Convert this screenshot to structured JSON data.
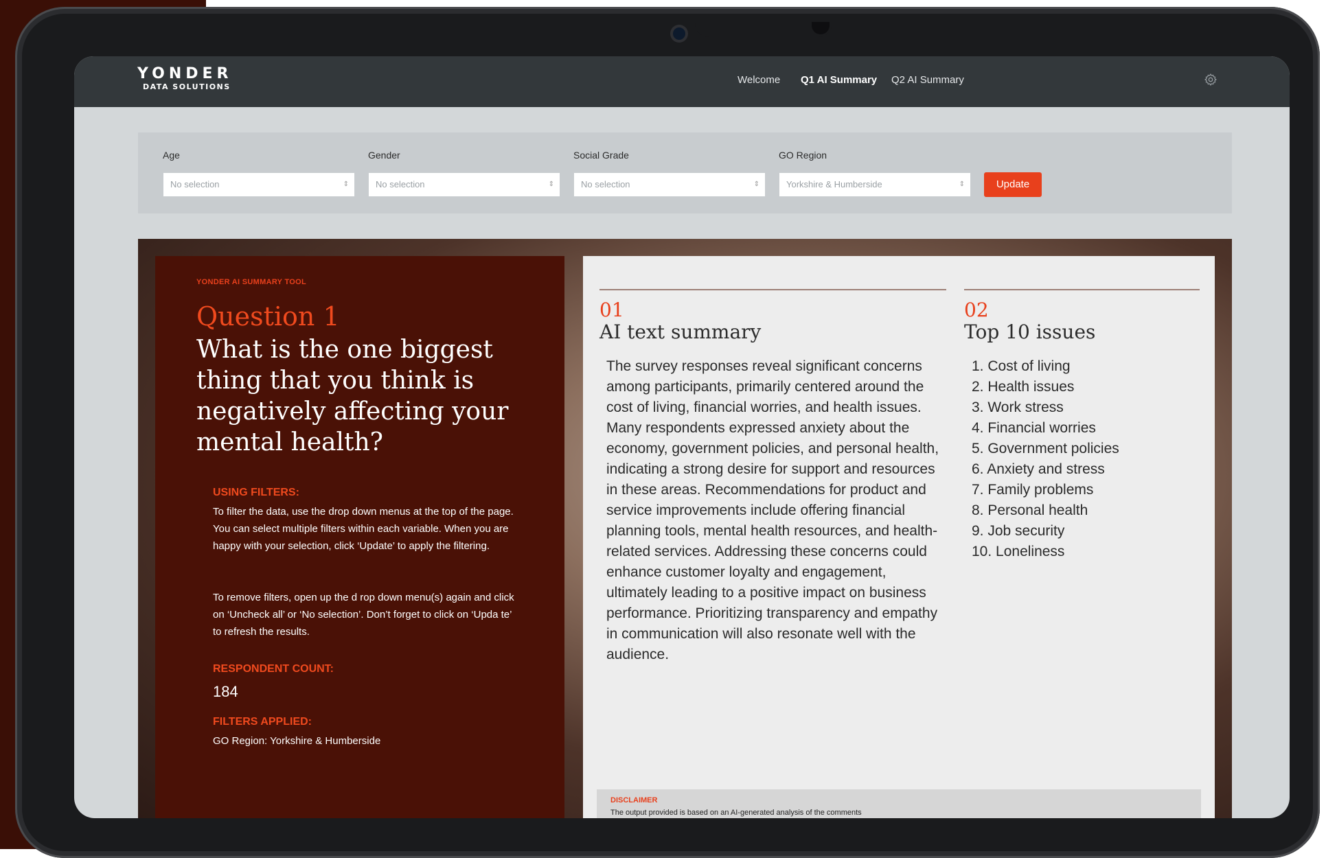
{
  "brand": {
    "name": "YONDER",
    "sub": "DATA SOLUTIONS"
  },
  "nav": [
    {
      "label": "Welcome"
    },
    {
      "label": "Q1 AI Summary",
      "active": true
    },
    {
      "label": "Q2 AI Summary"
    }
  ],
  "filters": [
    {
      "label": "Age",
      "value": "No selection"
    },
    {
      "label": "Gender",
      "value": "No selection"
    },
    {
      "label": "Social Grade",
      "value": "No selection"
    },
    {
      "label": "GO Region",
      "value": "Yorkshire & Humberside"
    }
  ],
  "update_label": "Update",
  "left": {
    "tag": "YONDER AI SUMMARY TOOL",
    "question_number": "Question 1",
    "question_text": "What is the one biggest thing that you think is negatively affecting your mental health?",
    "using_filters_heading": "USING FILTERS:",
    "using_filters_p1": "To filter the data, use the drop down menus at the top of the page. You can select multiple filters within each variable. When you are happy with your selection, click ‘Update’ to apply the filtering.",
    "using_filters_p2": "To remove filters, open up the d rop down menu(s) again and click on ‘Uncheck all’ or ‘No selection’. Don’t forget to click on ‘Upda te’ to refresh the results.",
    "respondent_heading": "RESPONDENT COUNT:",
    "respondent_count": "184",
    "filters_applied_heading": "FILTERS APPLIED:",
    "filters_applied_value": "GO Region: Yorkshire & Humberside"
  },
  "summary": {
    "num": "01",
    "title": "AI text summary",
    "text": "The survey responses reveal significant concerns among participants, primarily centered around the cost of living, financial worries, and health issues. Many respondents expressed anxiety about the economy, government policies, and personal health, indicating a strong desire for support and resources in these areas. Recommendations for product and service improvements include offering financial planning tools, mental health resources, and health-related services. Addressing these concerns could enhance customer loyalty and engagement, ultimately leading to a positive impact on business performance. Prioritizing transparency and empathy in communication will also resonate well with the audience."
  },
  "issues": {
    "num": "02",
    "title": "Top 10 issues",
    "items": [
      "1. Cost of living",
      "2. Health issues",
      "3. Work stress",
      "4. Financial worries",
      "5. Government policies",
      "6. Anxiety and stress",
      "7. Family problems",
      "8. Personal health",
      "9. Job security",
      "10. Loneliness"
    ]
  },
  "disclaimer": {
    "heading": "DISCLAIMER",
    "text": "The output provided is based on an AI-generated analysis of the comments"
  },
  "colors": {
    "accent": "#e8401c",
    "header": "#33383b",
    "left_card": "#4a1106"
  }
}
